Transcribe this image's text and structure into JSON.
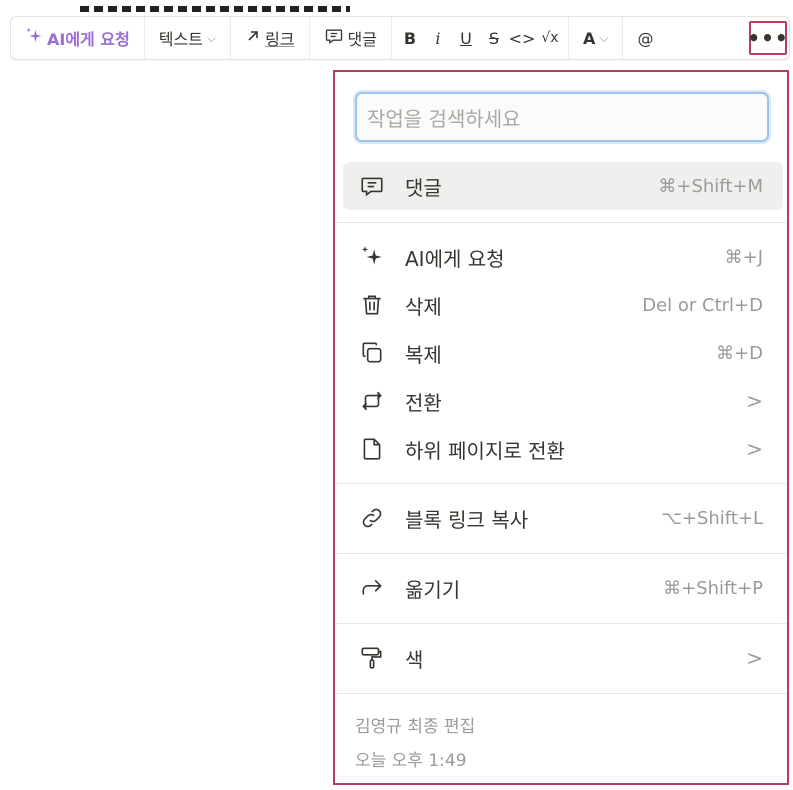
{
  "toolbar": {
    "ai_label": "AI에게 요청",
    "text_label": "텍스트",
    "link_label": "링크",
    "comment_label": "댓글",
    "bold": "B",
    "italic": "i",
    "underline": "U",
    "strike": "S",
    "code": "<>",
    "math": "√x",
    "color": "A",
    "mention": "@",
    "more": "•••"
  },
  "menu": {
    "search_placeholder": "작업을 검색하세요",
    "items": [
      {
        "icon": "comment-icon",
        "label": "댓글",
        "shortcut": "⌘+Shift+M"
      },
      {
        "icon": "sparkle-icon",
        "label": "AI에게 요청",
        "shortcut": "⌘+J"
      },
      {
        "icon": "trash-icon",
        "label": "삭제",
        "shortcut": "Del or Ctrl+D"
      },
      {
        "icon": "duplicate-icon",
        "label": "복제",
        "shortcut": "⌘+D"
      },
      {
        "icon": "turn-into-icon",
        "label": "전환",
        "shortcut": ">"
      },
      {
        "icon": "page-icon",
        "label": "하위 페이지로 전환",
        "shortcut": ">"
      },
      {
        "icon": "link-icon",
        "label": "블록 링크 복사",
        "shortcut": "⌥+Shift+L"
      },
      {
        "icon": "move-arrow-icon",
        "label": "옮기기",
        "shortcut": "⌘+Shift+P"
      },
      {
        "icon": "paint-roller-icon",
        "label": "색",
        "shortcut": ">"
      }
    ],
    "footer": {
      "edited_by": "김영규 최종 편집",
      "edited_time": "오늘 오후 1:49"
    }
  },
  "colors": {
    "ai_accent": "#9a6dd7",
    "highlight_border": "#b63d5e",
    "search_focus": "#9fc4ea"
  }
}
